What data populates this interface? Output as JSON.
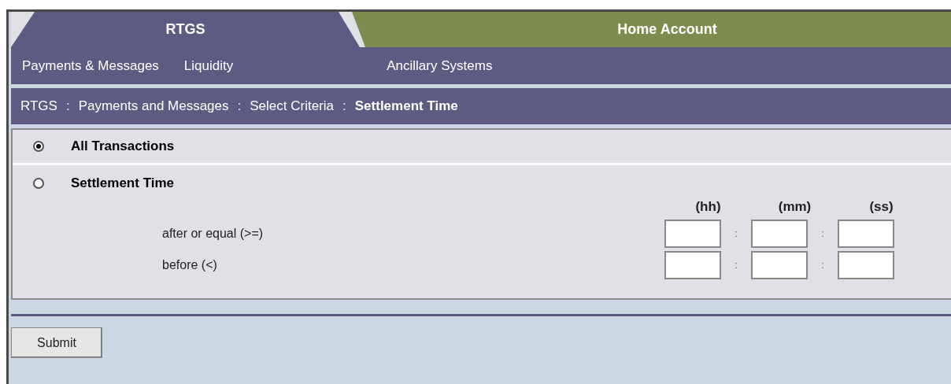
{
  "tabs": [
    {
      "label": "RTGS",
      "selected": true
    },
    {
      "label": "Home Account",
      "selected": false
    }
  ],
  "menu": [
    "Payments & Messages",
    "Liquidity",
    "Ancillary Systems"
  ],
  "breadcrumb": [
    {
      "kind": "crumb",
      "text": "RTGS",
      "current": false
    },
    {
      "text": ":",
      "kind": "sep"
    },
    {
      "kind": "crumb",
      "text": "Payments and Messages",
      "current": false
    },
    {
      "text": ":",
      "kind": "sep"
    },
    {
      "kind": "crumb",
      "text": "Select Criteria",
      "current": false
    },
    {
      "text": ":",
      "kind": "sep"
    },
    {
      "kind": "crumb",
      "text": "Settlement Time",
      "current": true
    }
  ],
  "options": [
    {
      "label": "All Transactions",
      "selected": true
    },
    {
      "label": "Settlement Time",
      "selected": false
    }
  ],
  "time_headers": [
    "(hh)",
    "(mm)",
    "(ss)"
  ],
  "time_rows": [
    {
      "label": "after or equal (>=)",
      "separators": [
        ":",
        ":"
      ]
    },
    {
      "label": "before (<)",
      "separators": [
        ":",
        ":"
      ]
    }
  ],
  "submit": "Submit"
}
